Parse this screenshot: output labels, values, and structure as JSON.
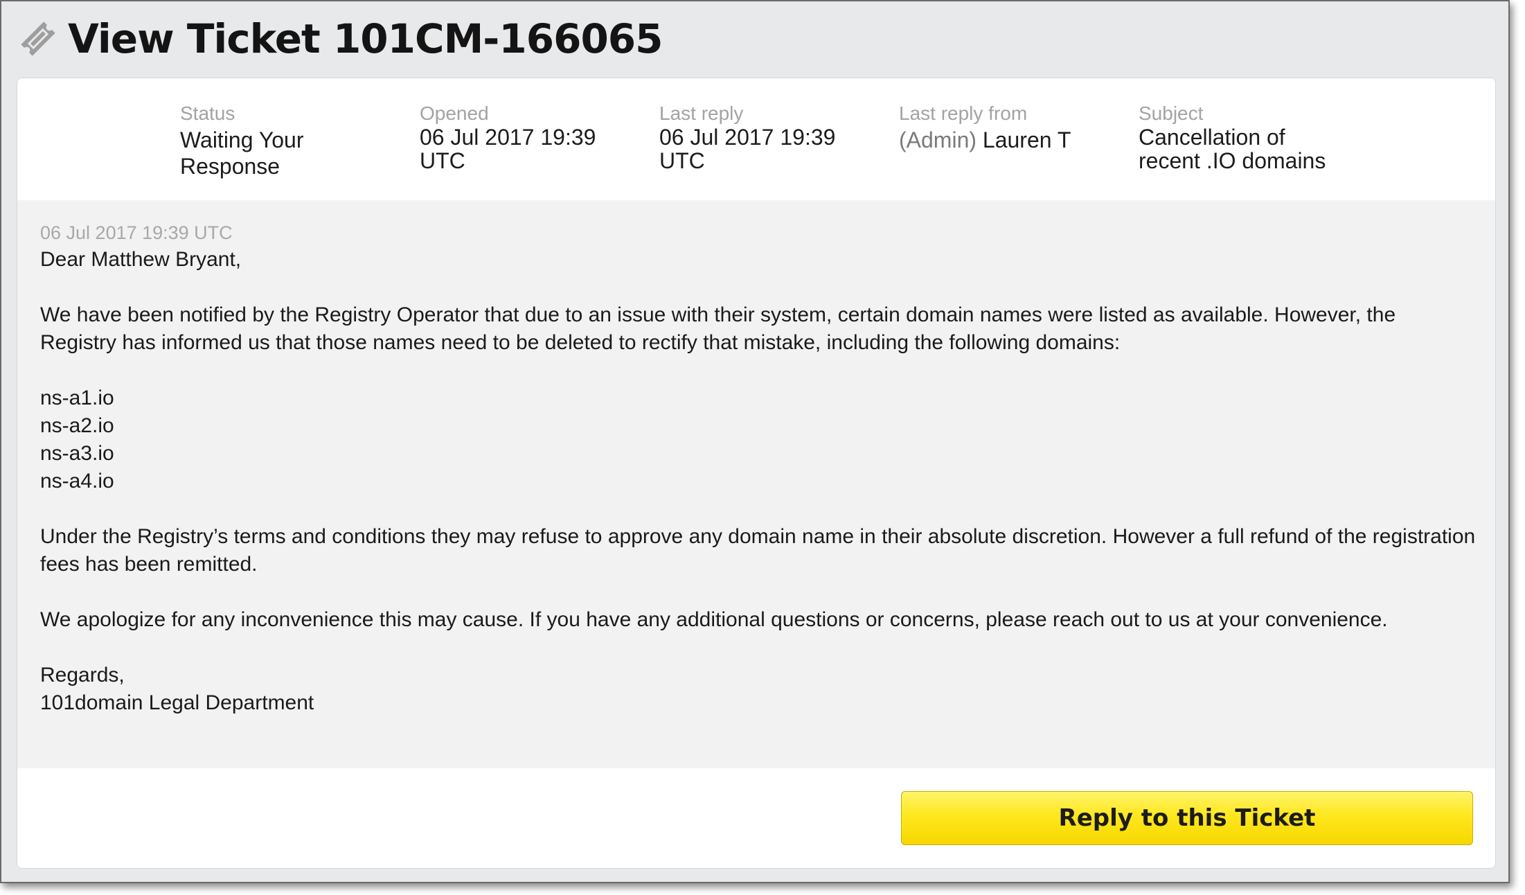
{
  "header": {
    "title": "View Ticket 101CM-166065",
    "icon": "ticket-icon"
  },
  "meta": {
    "status": {
      "label": "Status",
      "value": "Waiting Your Response"
    },
    "opened": {
      "label": "Opened",
      "line1": "06 Jul 2017 19:39",
      "line2": "UTC"
    },
    "last_reply": {
      "label": "Last reply",
      "line1": "06 Jul 2017 19:39",
      "line2": "UTC"
    },
    "last_reply_from": {
      "label": "Last reply from",
      "role": "(Admin)",
      "name": "Lauren T"
    },
    "subject": {
      "label": "Subject",
      "line1": "Cancellation of",
      "line2": "recent .IO domains"
    }
  },
  "message": {
    "date": "06 Jul 2017 19:39 UTC",
    "greeting": "Dear Matthew Bryant,",
    "paragraph1": "We have been notified by the Registry Operator that due to an issue with their system, certain domain names were listed as available. However, the Registry has informed us that those names need to be deleted to rectify that mistake, including the following domains:",
    "domains": [
      "ns-a1.io",
      "ns-a2.io",
      "ns-a3.io",
      "ns-a4.io"
    ],
    "paragraph2": "Under the Registry’s terms and conditions they may refuse to approve any domain name in their absolute discretion. However a full refund of the registration fees has been remitted.",
    "paragraph3": "We apologize for any inconvenience this may cause. If you have any additional questions or concerns, please reach out to us at your convenience.",
    "closing": "Regards,",
    "signature": "101domain Legal Department"
  },
  "footer": {
    "reply_label": "Reply to this Ticket"
  },
  "colors": {
    "button": "#ffe71e",
    "panel": "#f2f2f2",
    "frame": "#e8e9eb"
  }
}
